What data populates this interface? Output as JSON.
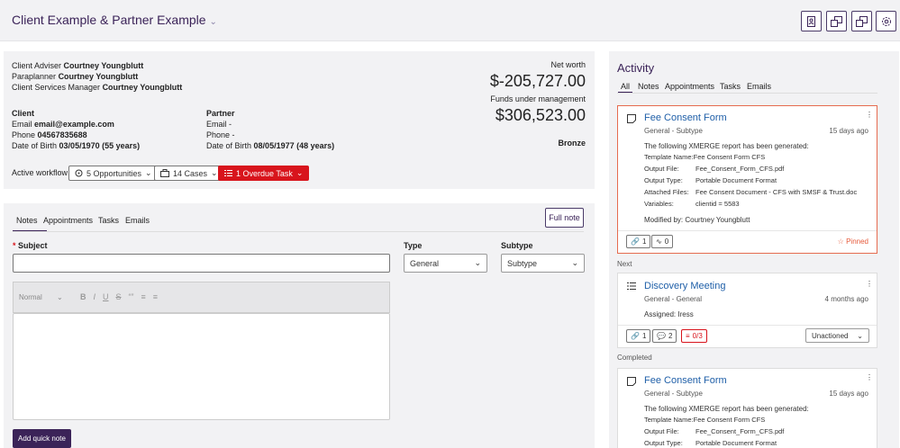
{
  "header": {
    "title": "Client Example & Partner Example",
    "icons": [
      "contact-card-icon",
      "swap-doc-icon",
      "swap-doc-icon",
      "gear-icon"
    ]
  },
  "client": {
    "adviser_label": "Client Adviser",
    "adviser": "Courtney Youngblutt",
    "paraplanner_label": "Paraplanner",
    "paraplanner": "Courtney Youngblutt",
    "csm_label": "Client Services Manager",
    "csm": "Courtney Youngblutt",
    "networth_label": "Net worth",
    "networth": "$-205,727.00",
    "fum_label": "Funds under management",
    "fum": "$306,523.00",
    "tier": "Bronze",
    "client_heading": "Client",
    "email_label": "Email",
    "email": "email@example.com",
    "phone_label": "Phone",
    "phone": "04567835688",
    "dob_label": "Date of Birth",
    "dob": "03/05/1970 (55 years)",
    "partner_heading": "Partner",
    "partner_email": "Email -",
    "partner_phone": "Phone -",
    "partner_dob": "08/05/1977 (48 years)",
    "workflow_label": "Active workflow",
    "opportunities": "5 Opportunities",
    "cases": "14 Cases",
    "overdue": "1 Overdue Task"
  },
  "notes": {
    "tabs": [
      "Notes",
      "Appointments",
      "Tasks",
      "Emails"
    ],
    "full_note": "Full note",
    "subject_label": "Subject",
    "type_label": "Type",
    "type_value": "General",
    "subtype_label": "Subtype",
    "subtype_value": "Subtype",
    "format_value": "Normal",
    "add_button": "Add quick note"
  },
  "activity": {
    "title": "Activity",
    "tabs": [
      "All",
      "Notes",
      "Appointments",
      "Tasks",
      "Emails"
    ],
    "next_label": "Next",
    "completed_label": "Completed",
    "cards": [
      {
        "title": "Fee Consent Form",
        "subtitle": "General - Subtype",
        "time": "15 days ago",
        "line1": "The following XMERGE report has been generated:",
        "template_label": "Template Name:",
        "template": "Fee Consent Form CFS",
        "output_file_label": "Output File:",
        "output_file": "Fee_Consent_Form_CFS.pdf",
        "output_type_label": "Output Type:",
        "output_type": "Portable Document Format",
        "attached_label": "Attached Files:",
        "attached": "Fee Consent Document - CFS with SMSF & Trust.doc",
        "variables_label": "Variables:",
        "variables": "clientid = 5583",
        "modified": "Modified by: Courtney Youngblutt",
        "links": "1",
        "steps": "0",
        "pinned": "Pinned"
      },
      {
        "title": "Discovery Meeting",
        "subtitle": "General - General",
        "time": "4 months ago",
        "assigned": "Assigned: Iress",
        "links": "1",
        "comments": "2",
        "tasks": "0/3",
        "status": "Unactioned"
      },
      {
        "title": "Fee Consent Form",
        "subtitle": "General - Subtype",
        "time": "15 days ago",
        "line1": "The following XMERGE report has been generated:",
        "template_label": "Template Name:",
        "template": "Fee Consent Form CFS",
        "output_file_label": "Output File:",
        "output_file": "Fee_Consent_Form_CFS.pdf",
        "output_type_label": "Output Type:",
        "output_type": "Portable Document Format"
      }
    ]
  },
  "colors": {
    "brand": "#3b2358",
    "danger": "#d8141c",
    "link": "#1f5fa8",
    "pinned_border": "#e66b4f"
  }
}
